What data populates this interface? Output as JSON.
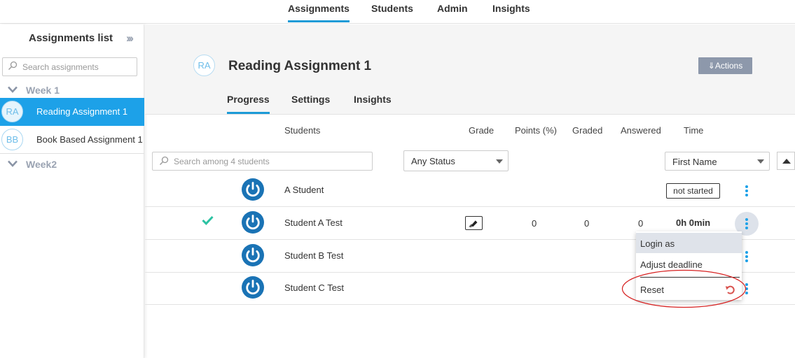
{
  "topnav": {
    "tabs": [
      {
        "label": "Assignments",
        "active": true
      },
      {
        "label": "Students"
      },
      {
        "label": "Admin"
      },
      {
        "label": "Insights"
      }
    ]
  },
  "sidebar": {
    "title": "Assignments list",
    "collapse_icon": "double-chevron-right-icon",
    "search_placeholder": "Search assignments",
    "weeks": [
      {
        "label": "Week 1",
        "items": [
          {
            "initials": "RA",
            "name": "Reading Assignment 1",
            "selected": true
          },
          {
            "initials": "BB",
            "name": "Book Based Assignment 1"
          }
        ]
      },
      {
        "label": "Week2",
        "items": []
      }
    ]
  },
  "assignment": {
    "initials": "RA",
    "title": "Reading Assignment 1",
    "actions_label": "⇓Actions",
    "tabs": [
      "Progress",
      "Settings",
      "Insights"
    ],
    "active_tab": "Progress"
  },
  "table": {
    "columns": [
      "Students",
      "Grade",
      "Points (%)",
      "Graded",
      "Answered",
      "Time"
    ],
    "search_placeholder": "Search among 4 students",
    "status_filter": "Any Status",
    "sort_field": "First Name",
    "rows": [
      {
        "name": "A Student",
        "status": "not started"
      },
      {
        "name": "Student A Test",
        "completed": true,
        "points": "0",
        "graded": "0",
        "answered": "0",
        "time": "0h 0min",
        "menu_open": true
      },
      {
        "name": "Student B Test"
      },
      {
        "name": "Student C Test"
      }
    ]
  },
  "row_menu": {
    "items": [
      "Login as",
      "Adjust deadline",
      "Reset"
    ],
    "hovered": "Login as"
  },
  "colors": {
    "accent": "#1da1e8",
    "annotation": "#d62020",
    "power_icon": "#1a73b5"
  }
}
